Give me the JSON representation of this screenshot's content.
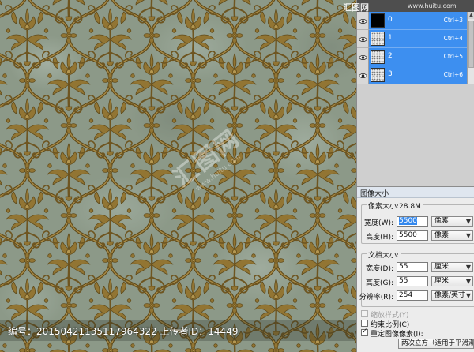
{
  "watermark": {
    "site_name": "汇图网",
    "site_url": "www.huitu.com",
    "caption": "编号：20150421135117964322 上传者ID：14449"
  },
  "channels": [
    {
      "name": "0",
      "shortcut": "Ctrl+3"
    },
    {
      "name": "1",
      "shortcut": "Ctrl+4"
    },
    {
      "name": "2",
      "shortcut": "Ctrl+5"
    },
    {
      "name": "3",
      "shortcut": "Ctrl+6"
    }
  ],
  "icons": {
    "visibility": "eye-icon",
    "dropdown": "chevron-down-icon",
    "scroll_up": "arrow-up-icon"
  },
  "image_size_dialog": {
    "title": "图像大小",
    "pixel_dimensions": {
      "legend": "像素大小:28.8M",
      "width": {
        "label": "宽度(W):",
        "value": "5500",
        "unit": "像素"
      },
      "height": {
        "label": "高度(H):",
        "value": "5500",
        "unit": "像素"
      }
    },
    "document_size": {
      "legend": "文档大小:",
      "width": {
        "label": "宽度(D):",
        "value": "55",
        "unit": "厘米"
      },
      "height": {
        "label": "高度(G):",
        "value": "55",
        "unit": "厘米"
      },
      "resolution": {
        "label": "分辨率(R):",
        "value": "254",
        "unit": "像素/英寸"
      }
    },
    "options": {
      "scale_styles": {
        "label": "缩放样式(Y)",
        "checked": false,
        "enabled": false
      },
      "constrain_proportions": {
        "label": "约束比例(C)",
        "checked": false,
        "enabled": true
      },
      "resample_image": {
        "label": "重定图像像素(I):",
        "checked": true,
        "enabled": true
      }
    },
    "resample_method": "两次立方（适用于平滑渐变）"
  },
  "colors": {
    "selection": "#3d8ff0",
    "canvas_base": "#8c9988",
    "ornament": "#927533"
  }
}
